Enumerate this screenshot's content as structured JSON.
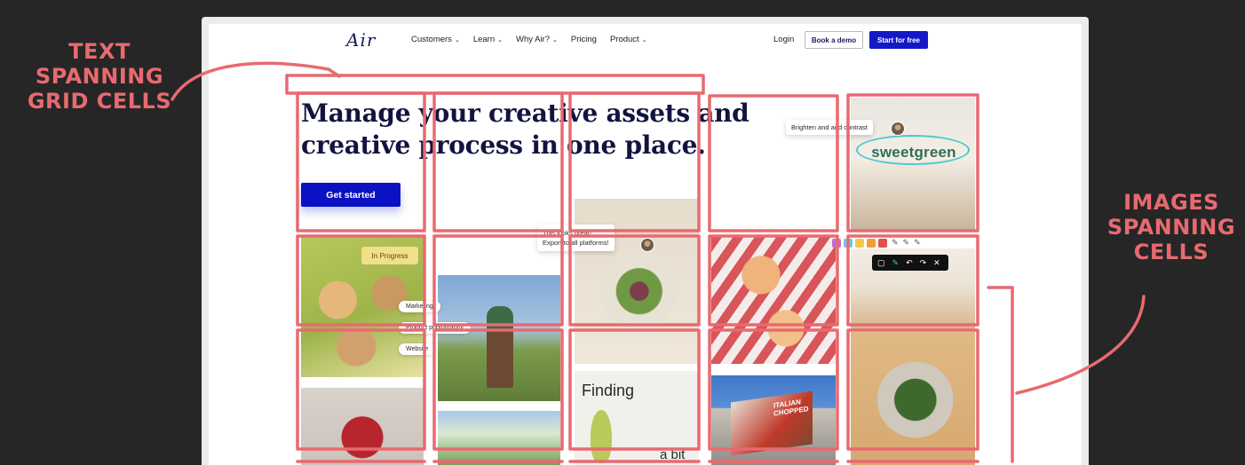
{
  "nav": {
    "logo": "Air",
    "items": [
      {
        "label": "Customers",
        "has_dropdown": true
      },
      {
        "label": "Learn",
        "has_dropdown": true
      },
      {
        "label": "Why Air?",
        "has_dropdown": true
      },
      {
        "label": "Pricing",
        "has_dropdown": false
      },
      {
        "label": "Product",
        "has_dropdown": true
      }
    ],
    "login": "Login",
    "book_demo": "Book a demo",
    "start_free": "Start for free"
  },
  "hero": {
    "title": "Manage your creative assets and creative process in one place.",
    "cta": "Get started"
  },
  "chips": {
    "brighten": "Brighten and add contrast",
    "comment_line1": "This looks great!",
    "comment_line2": "Export to all platforms!",
    "in_progress": "In Progress",
    "tags": [
      "Marketing",
      "Product photography",
      "Website"
    ]
  },
  "tiles": {
    "sweetgreen": "sweetgreen",
    "finding_1": "Finding",
    "finding_2": "a bit",
    "billboard": "ITALIAN CHOPPED"
  },
  "swatch_colors": [
    "#c56bd8",
    "#6ec8ea",
    "#f2c94c",
    "#f29c38",
    "#e0514d"
  ],
  "annotations": {
    "left": "TEXT SPANNING GRID CELLS",
    "right": "IMAGES SPANNING CELLS",
    "color": "#e86a70"
  }
}
